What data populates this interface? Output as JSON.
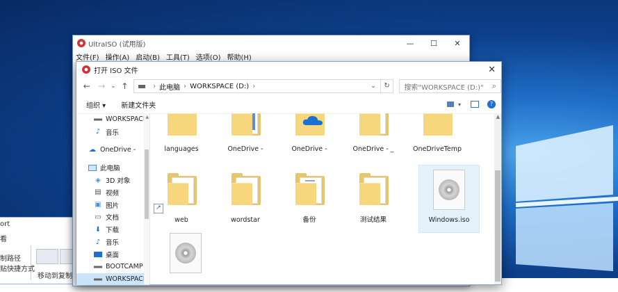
{
  "background_window": {
    "text1": "ort",
    "text2": "看",
    "text3": "制路径",
    "text4": "贴快捷方式",
    "move_label": "移动到",
    "copy_label": "复制"
  },
  "ultraiso": {
    "title": "UltraISO (试用版)",
    "menu": [
      "文件(F)",
      "操作(A)",
      "启动(B)",
      "工具(T)",
      "选项(O)",
      "帮助(H)"
    ],
    "controls": {
      "minimize": "—",
      "maximize": "☐",
      "close": "✕"
    }
  },
  "dialog": {
    "title": "打开 ISO 文件",
    "close": "✕",
    "nav": {
      "back": "←",
      "forward": "→",
      "recent": "⌄",
      "up": "↑"
    },
    "address": {
      "segments": [
        "此电脑",
        "WORKSPACE (D:)"
      ],
      "separator": "›",
      "dropdown": "⌄",
      "refresh": "↻"
    },
    "search": {
      "placeholder": "搜索\"WORKSPACE (D:)\"",
      "icon": "⌕"
    },
    "commands": {
      "organize": "组织 ▾",
      "new_folder": "新建文件夹",
      "view_dropdown": "▾",
      "help": "?"
    },
    "sidebar": [
      {
        "label": "WORKSPACE (D:",
        "icon": "drive-icon",
        "level": 1
      },
      {
        "label": "音乐",
        "icon": "music-icon",
        "level": 1
      },
      {
        "label": "OneDrive -",
        "icon": "onedrive-icon",
        "level": 0,
        "gap": true
      },
      {
        "label": "此电脑",
        "icon": "computer-icon",
        "level": 0,
        "gap": true
      },
      {
        "label": "3D 对象",
        "icon": "3d-objects-icon",
        "level": 1
      },
      {
        "label": "视频",
        "icon": "video-icon",
        "level": 1
      },
      {
        "label": "图片",
        "icon": "pictures-icon",
        "level": 1
      },
      {
        "label": "文档",
        "icon": "documents-icon",
        "level": 1
      },
      {
        "label": "下载",
        "icon": "download-icon",
        "level": 1
      },
      {
        "label": "音乐",
        "icon": "music-icon",
        "level": 1
      },
      {
        "label": "桌面",
        "icon": "desktop-icon",
        "level": 1
      },
      {
        "label": "BOOTCAMP (C",
        "icon": "drive-icon",
        "level": 1
      },
      {
        "label": "WORKSPACE (D",
        "icon": "drive-icon",
        "level": 1,
        "selected": true
      }
    ],
    "files": [
      {
        "name": "languages",
        "kind": "folder"
      },
      {
        "name": "OneDrive -",
        "kind": "folder-doc"
      },
      {
        "name": "OneDrive -",
        "kind": "folder-cloud"
      },
      {
        "name": "OneDrive - _",
        "kind": "folder-doc"
      },
      {
        "name": "OneDriveTemp",
        "kind": "folder"
      },
      {
        "name": "web",
        "kind": "folder-doc",
        "shortcut": true
      },
      {
        "name": "wordstar",
        "kind": "folder-doc"
      },
      {
        "name": "备份",
        "kind": "folder-lines"
      },
      {
        "name": "测试结果",
        "kind": "folder-doc"
      },
      {
        "name": "Windows.iso",
        "kind": "iso",
        "selected": true
      },
      {
        "name": "",
        "kind": "iso"
      }
    ]
  },
  "colors": {
    "folder": "#f6d77d",
    "accent": "#1d6fd1",
    "selection": "#cce4f7"
  }
}
